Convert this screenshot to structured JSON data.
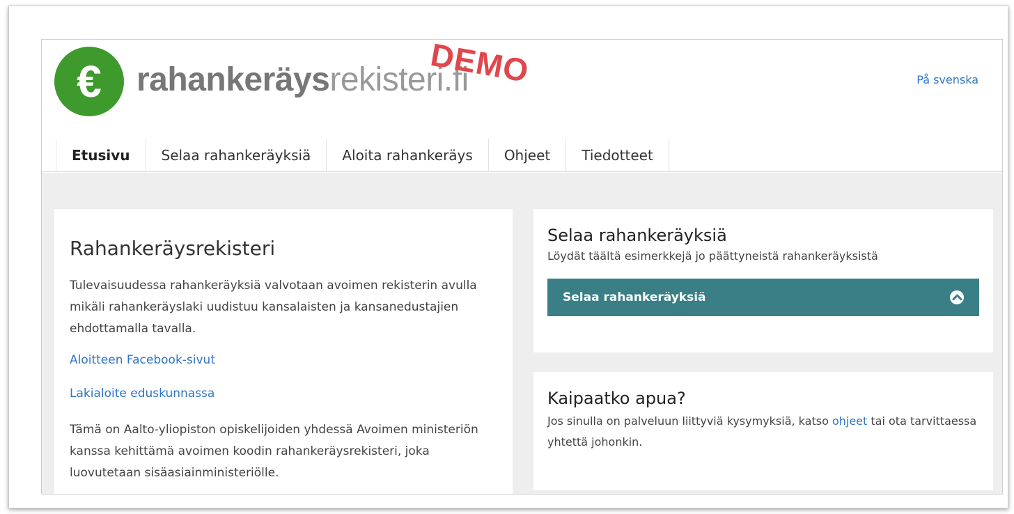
{
  "header": {
    "logo_symbol": "€",
    "logo_text_bold": "rahankeräys",
    "logo_text_light": "rekisteri.fi",
    "demo_label": "DEMO",
    "language_link": "På svenska"
  },
  "nav": {
    "tabs": [
      {
        "label": "Etusivu",
        "active": true
      },
      {
        "label": "Selaa rahankeräyksiä",
        "active": false
      },
      {
        "label": "Aloita rahankeräys",
        "active": false
      },
      {
        "label": "Ohjeet",
        "active": false
      },
      {
        "label": "Tiedotteet",
        "active": false
      }
    ]
  },
  "main": {
    "title": "Rahankeräysrekisteri",
    "intro": "Tulevaisuudessa rahankeräyksiä valvotaan avoimen rekisterin avulla mikäli rahankeräyslaki uudistuu kansalaisten ja kansanedustajien ehdottamalla tavalla.",
    "link_facebook": "Aloitteen Facebook-sivut",
    "link_parliament": "Lakialoite eduskunnassa",
    "about": "Tämä on Aalto-yliopiston opiskelijoiden yhdessä Avoimen ministeriön kanssa kehittämä avoimen koodin rahankeräysrekisteri, joka luovutetaan sisäasiainministeriölle."
  },
  "browse_card": {
    "title": "Selaa rahankeräyksiä",
    "subtitle": "Löydät täältä esimerkkejä jo päättyneistä rahankeräyksistä",
    "button_label": "Selaa rahankeräyksiä",
    "button_icon": "circle-arrow-icon"
  },
  "help_card": {
    "title": "Kaipaatko apua?",
    "text_before": "Jos sinulla on palveluun liittyviä kysymyksiä, katso",
    "link_label": "ohjeet",
    "text_after": "tai ota tarvittaessa yhtettä johonkin."
  },
  "colors": {
    "logo_green": "#3e9a2c",
    "demo_red": "#e0474c",
    "button_teal": "#3a7f86",
    "link_blue": "#2f74c5",
    "content_bg": "#eeeeee"
  }
}
